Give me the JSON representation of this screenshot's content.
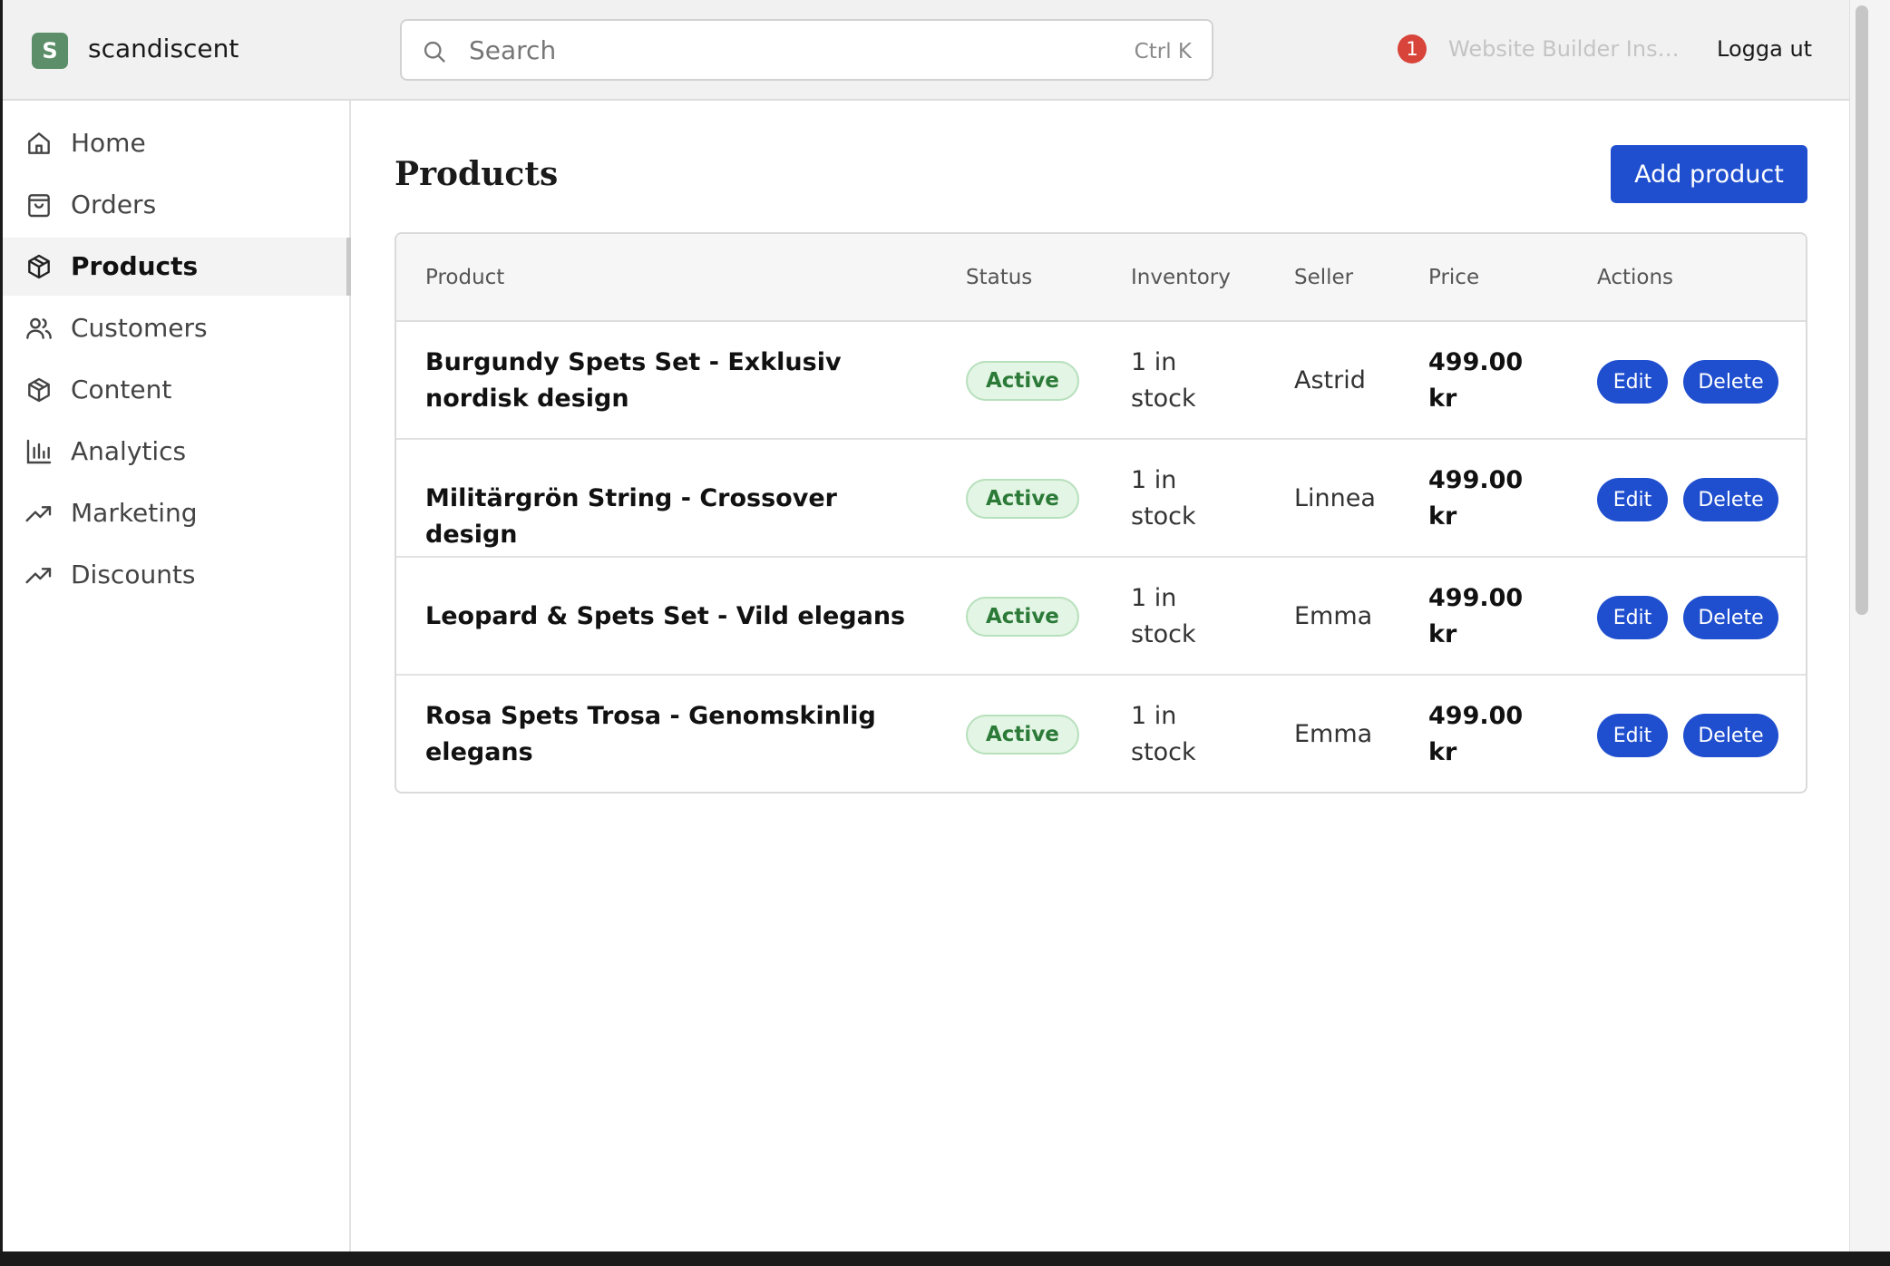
{
  "header": {
    "logo_letter": "S",
    "store_name": "scandiscent",
    "search_placeholder": "Search",
    "search_shortcut": "Ctrl K",
    "notification_count": "1",
    "site_name": "Website Builder Insid...",
    "logout_label": "Logga ut"
  },
  "sidebar": {
    "items": [
      {
        "label": "Home",
        "icon": "home-icon"
      },
      {
        "label": "Orders",
        "icon": "shopping-bag-icon"
      },
      {
        "label": "Products",
        "icon": "package-icon",
        "active": true
      },
      {
        "label": "Customers",
        "icon": "users-icon"
      },
      {
        "label": "Content",
        "icon": "package-icon"
      },
      {
        "label": "Analytics",
        "icon": "bar-chart-icon"
      },
      {
        "label": "Marketing",
        "icon": "trending-up-icon"
      },
      {
        "label": "Discounts",
        "icon": "trending-up-icon"
      }
    ]
  },
  "main": {
    "title": "Products",
    "add_button": "Add product",
    "columns": [
      "Product",
      "Status",
      "Inventory",
      "Seller",
      "Price",
      "Actions"
    ],
    "rows": [
      {
        "product": "Burgundy Spets Set - Exklusiv nordisk design",
        "status": "Active",
        "inventory": "1 in stock",
        "seller": "Astrid",
        "price": "499.00 kr",
        "edit": "Edit",
        "delete": "Delete"
      },
      {
        "product": "Militärgrön String - Crossover design",
        "status": "Active",
        "inventory": "1 in stock",
        "seller": "Linnea",
        "price": "499.00 kr",
        "edit": "Edit",
        "delete": "Delete"
      },
      {
        "product": "Leopard & Spets Set - Vild elegans",
        "status": "Active",
        "inventory": "1 in stock",
        "seller": "Emma",
        "price": "499.00 kr",
        "edit": "Edit",
        "delete": "Delete"
      },
      {
        "product": "Rosa Spets Trosa - Genomskinlig elegans",
        "status": "Active",
        "inventory": "1 in stock",
        "seller": "Emma",
        "price": "499.00 kr",
        "edit": "Edit",
        "delete": "Delete"
      }
    ]
  },
  "colors": {
    "primary_button": "#1f4fcf",
    "logo_badge": "#5c8f69",
    "notification_badge": "#d8443a",
    "status_active_bg": "#e3f5e4",
    "status_active_text": "#2c7a38"
  }
}
